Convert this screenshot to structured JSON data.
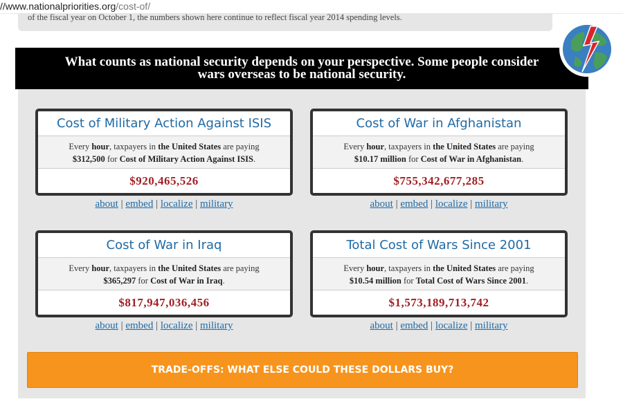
{
  "address_bar": {
    "host": "//www.nationalpriorities.org",
    "path": "/cost-of/"
  },
  "notice": {
    "text": "of the fiscal year on October 1, the numbers shown here continue to reflect fiscal year 2014 spending levels."
  },
  "banner": {
    "text": "What counts as national security depends on your perspective. Some people consider wars overseas to be national security."
  },
  "logo": {
    "icon": "globe-lightning-logo",
    "colors": {
      "globe": "#4a9e5c",
      "water": "#3a7fc1",
      "bolt": "#d9262c"
    }
  },
  "cards": [
    {
      "title": "Cost of Military Action Against ISIS",
      "desc": {
        "prefix": "Every ",
        "unit": "hour",
        "mid": ", taxpayers in ",
        "place": "the United States",
        "suffix": " are paying",
        "amount": "$312,500",
        "for_text": " for ",
        "item": "Cost of Military Action Against ISIS",
        "end": "."
      },
      "total": "$920,465,526"
    },
    {
      "title": "Cost of War in Afghanistan",
      "desc": {
        "prefix": "Every ",
        "unit": "hour",
        "mid": ", taxpayers in ",
        "place": "the United States",
        "suffix": " are paying",
        "amount": "$10.17 million",
        "for_text": " for ",
        "item": "Cost of War in Afghanistan",
        "end": "."
      },
      "total": "$755,342,677,285"
    },
    {
      "title": "Cost of War in Iraq",
      "desc": {
        "prefix": "Every ",
        "unit": "hour",
        "mid": ", taxpayers in ",
        "place": "the United States",
        "suffix": " are paying",
        "amount": "$365,297",
        "for_text": " for ",
        "item": "Cost of War in Iraq",
        "end": "."
      },
      "total": "$817,947,036,456"
    },
    {
      "title": "Total Cost of Wars Since 2001",
      "desc": {
        "prefix": "Every ",
        "unit": "hour",
        "mid": ", taxpayers in ",
        "place": "the United States",
        "suffix": " are paying",
        "amount": "$10.54 million",
        "for_text": " for ",
        "item": "Total Cost of Wars Since 2001",
        "end": "."
      },
      "total": "$1,573,189,713,742"
    }
  ],
  "links": {
    "about": "about",
    "embed": "embed",
    "localize": "localize",
    "military": "military",
    "separator": "|"
  },
  "tradeoffs_button": "TRADE-OFFS: WHAT ELSE COULD THESE DOLLARS BUY?",
  "colors": {
    "accent_orange": "#f7941d",
    "title_blue": "#1f6aa5",
    "total_red": "#a11f24",
    "banner_black": "#000000"
  }
}
